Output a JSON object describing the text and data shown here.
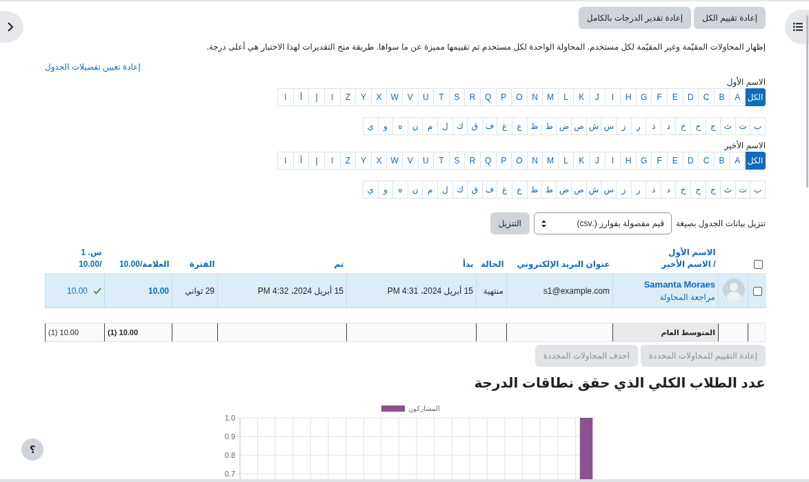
{
  "help_button": "؟",
  "top_buttons": [
    "إعادة تقييم الكل",
    "إعادة تقدير الدرجات بالكامل"
  ],
  "info": "إظهار المحاولات المقيّمة وغير المقيّمة لكل مستخدم. المحاولة الواحدة لكل مستخدم تم تقييمها مميزة عن ما سواها. طريقة منح التقديرات لهذا الاختبار هي أعلى درجة.",
  "reset_link": "إعادة تعيين تفضيلات الجدول",
  "filters": [
    {
      "label": "الاسم الأول",
      "latin": [
        {
          "text": "الكل",
          "selected": true
        },
        {
          "text": "A",
          "selected": false
        },
        {
          "text": "B",
          "selected": false
        },
        {
          "text": "C",
          "selected": false
        },
        {
          "text": "D",
          "selected": false
        },
        {
          "text": "E",
          "selected": false
        },
        {
          "text": "F",
          "selected": false
        },
        {
          "text": "G",
          "selected": false
        },
        {
          "text": "H",
          "selected": false
        },
        {
          "text": "I",
          "selected": false
        },
        {
          "text": "J",
          "selected": false
        },
        {
          "text": "K",
          "selected": false
        },
        {
          "text": "L",
          "selected": false
        },
        {
          "text": "M",
          "selected": false
        },
        {
          "text": "N",
          "selected": false
        },
        {
          "text": "O",
          "selected": false
        },
        {
          "text": "P",
          "selected": false
        },
        {
          "text": "Q",
          "selected": false
        },
        {
          "text": "R",
          "selected": false
        },
        {
          "text": "S",
          "selected": false
        },
        {
          "text": "T",
          "selected": false
        },
        {
          "text": "U",
          "selected": false
        },
        {
          "text": "V",
          "selected": false
        },
        {
          "text": "W",
          "selected": false
        },
        {
          "text": "X",
          "selected": false
        },
        {
          "text": "Y",
          "selected": false
        },
        {
          "text": "Z",
          "selected": false
        },
        {
          "text": "ا",
          "selected": false
        },
        {
          "text": "إ",
          "selected": false
        },
        {
          "text": "أ",
          "selected": false
        },
        {
          "text": "ا",
          "selected": false
        }
      ],
      "arabic": [
        {
          "text": "ب",
          "selected": false
        },
        {
          "text": "ت",
          "selected": false
        },
        {
          "text": "ث",
          "selected": false
        },
        {
          "text": "ج",
          "selected": false
        },
        {
          "text": "ح",
          "selected": false
        },
        {
          "text": "خ",
          "selected": false
        },
        {
          "text": "د",
          "selected": false
        },
        {
          "text": "ذ",
          "selected": false
        },
        {
          "text": "ر",
          "selected": false
        },
        {
          "text": "ز",
          "selected": false
        },
        {
          "text": "س",
          "selected": false
        },
        {
          "text": "ش",
          "selected": false
        },
        {
          "text": "ص",
          "selected": false
        },
        {
          "text": "ض",
          "selected": false
        },
        {
          "text": "ط",
          "selected": false
        },
        {
          "text": "ظ",
          "selected": false
        },
        {
          "text": "ع",
          "selected": false
        },
        {
          "text": "غ",
          "selected": false
        },
        {
          "text": "ف",
          "selected": false
        },
        {
          "text": "ق",
          "selected": false
        },
        {
          "text": "ك",
          "selected": false
        },
        {
          "text": "ل",
          "selected": false
        },
        {
          "text": "م",
          "selected": false
        },
        {
          "text": "ن",
          "selected": false
        },
        {
          "text": "ه",
          "selected": false
        },
        {
          "text": "و",
          "selected": false
        },
        {
          "text": "ي",
          "selected": false
        }
      ]
    },
    {
      "label": "الاسم الأخير",
      "latin": [
        {
          "text": "الكل",
          "selected": true
        },
        {
          "text": "A",
          "selected": false
        },
        {
          "text": "B",
          "selected": false
        },
        {
          "text": "C",
          "selected": false
        },
        {
          "text": "D",
          "selected": false
        },
        {
          "text": "E",
          "selected": false
        },
        {
          "text": "F",
          "selected": false
        },
        {
          "text": "G",
          "selected": false
        },
        {
          "text": "H",
          "selected": false
        },
        {
          "text": "I",
          "selected": false
        },
        {
          "text": "J",
          "selected": false
        },
        {
          "text": "K",
          "selected": false
        },
        {
          "text": "L",
          "selected": false
        },
        {
          "text": "M",
          "selected": false
        },
        {
          "text": "N",
          "selected": false
        },
        {
          "text": "O",
          "selected": false
        },
        {
          "text": "P",
          "selected": false
        },
        {
          "text": "Q",
          "selected": false
        },
        {
          "text": "R",
          "selected": false
        },
        {
          "text": "S",
          "selected": false
        },
        {
          "text": "T",
          "selected": false
        },
        {
          "text": "U",
          "selected": false
        },
        {
          "text": "V",
          "selected": false
        },
        {
          "text": "W",
          "selected": false
        },
        {
          "text": "X",
          "selected": false
        },
        {
          "text": "Y",
          "selected": false
        },
        {
          "text": "Z",
          "selected": false
        },
        {
          "text": "ا",
          "selected": false
        },
        {
          "text": "إ",
          "selected": false
        },
        {
          "text": "أ",
          "selected": false
        },
        {
          "text": "ا",
          "selected": false
        }
      ],
      "arabic": [
        {
          "text": "ب",
          "selected": false
        },
        {
          "text": "ت",
          "selected": false
        },
        {
          "text": "ث",
          "selected": false
        },
        {
          "text": "ج",
          "selected": false
        },
        {
          "text": "ح",
          "selected": false
        },
        {
          "text": "خ",
          "selected": false
        },
        {
          "text": "د",
          "selected": false
        },
        {
          "text": "ذ",
          "selected": false
        },
        {
          "text": "ر",
          "selected": false
        },
        {
          "text": "ز",
          "selected": false
        },
        {
          "text": "س",
          "selected": false
        },
        {
          "text": "ش",
          "selected": false
        },
        {
          "text": "ص",
          "selected": false
        },
        {
          "text": "ض",
          "selected": false
        },
        {
          "text": "ط",
          "selected": false
        },
        {
          "text": "ظ",
          "selected": false
        },
        {
          "text": "ع",
          "selected": false
        },
        {
          "text": "غ",
          "selected": false
        },
        {
          "text": "ف",
          "selected": false
        },
        {
          "text": "ق",
          "selected": false
        },
        {
          "text": "ك",
          "selected": false
        },
        {
          "text": "ل",
          "selected": false
        },
        {
          "text": "م",
          "selected": false
        },
        {
          "text": "ن",
          "selected": false
        },
        {
          "text": "ه",
          "selected": false
        },
        {
          "text": "و",
          "selected": false
        },
        {
          "text": "ي",
          "selected": false
        }
      ]
    }
  ],
  "download": {
    "label": "تنزيل بيانات الجدول بصيغة",
    "format": "قيم مفصولة بفوارز (.csv)",
    "button": "التنزيل"
  },
  "table": {
    "header_checked": false,
    "columns": [
      {
        "label": "الاسم الأول",
        "sub": "/ الاسم الأخير"
      },
      {
        "label": "عنوان البريد الإلكتروني"
      },
      {
        "label": "الحالة"
      },
      {
        "label": "بدأ"
      },
      {
        "label": "تم"
      },
      {
        "label": "الفترة"
      },
      {
        "label": "العلامة/10.00"
      },
      {
        "label": "س. 1",
        "sub": "/10.00"
      }
    ],
    "rows": [
      {
        "highlighted": true,
        "checked": false,
        "name": "Samanta Moraes",
        "review_link": "مراجعة المحاولة",
        "email": "s1@example.com",
        "status": "منتهية",
        "started": "15 أبريل 2024، 4:31 PM",
        "completed": "15 أبريل 2024، 4:32 PM",
        "duration": "29 ثواني",
        "grade": "10.00",
        "q1": "10.00",
        "q1_correct": true
      }
    ],
    "average": {
      "label": "المتوسط العام",
      "grade": "10.00 (1)",
      "q1": "10.00 (1)"
    }
  },
  "bulk_buttons": [
    {
      "label": "إعادة التقييم للمحاولات المحددة",
      "disabled": true
    },
    {
      "label": "احذف المحاولات المحددة",
      "disabled": true
    }
  ],
  "chart_heading": "عدد الطلاب الكلي الذي حقق نطاقات الدرجة",
  "chart_data": {
    "type": "bar",
    "series": [
      {
        "name": "المشاركون",
        "color": "#8a5290",
        "values": [
          null,
          null,
          null,
          null,
          null,
          null,
          null,
          null,
          null,
          null,
          null,
          null,
          null,
          null,
          null,
          null,
          null,
          null,
          null,
          1
        ]
      }
    ],
    "grid": true,
    "ylim": [
      0.66,
      1.0
    ],
    "yticks": [
      {
        "value": 0.7,
        "label": "0.7"
      },
      {
        "value": 0.8,
        "label": "0.8"
      },
      {
        "value": 0.9,
        "label": "0.9"
      },
      {
        "value": 1,
        "label": "1.0"
      }
    ]
  }
}
